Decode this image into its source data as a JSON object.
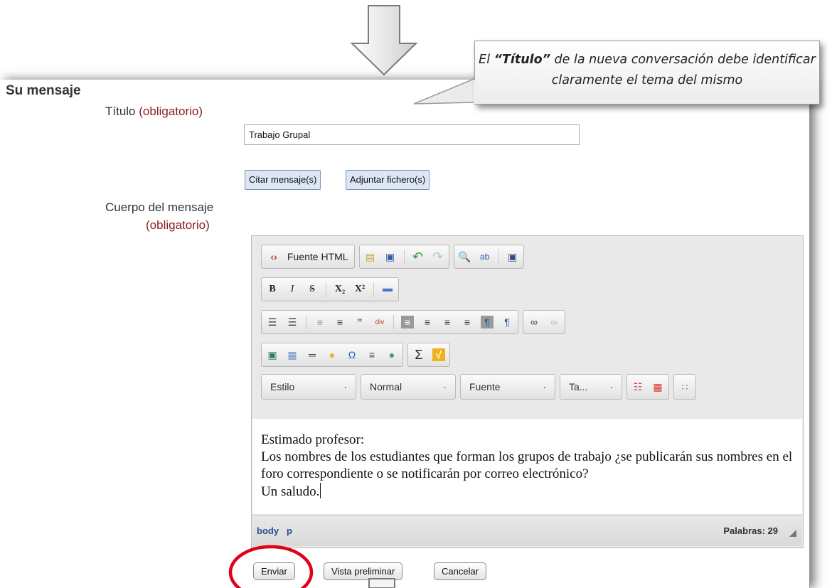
{
  "section_title": "Su mensaje",
  "title_field": {
    "label": "Título",
    "required": "(obligatorio)",
    "value": "Trabajo Grupal"
  },
  "buttons": {
    "quote": "Citar mensaje(s)",
    "attach": "Adjuntar fichero(s)"
  },
  "body_field": {
    "label": "Cuerpo del mensaje",
    "required": "(obligatorio)"
  },
  "editor": {
    "source_button": "Fuente HTML",
    "combos": {
      "style": "Estilo",
      "format": "Normal",
      "font": "Fuente",
      "size": "Ta..."
    },
    "content": {
      "line1": "Estimado profesor:",
      "line2": "Los nombres de los estudiantes que forman los grupos de trabajo ¿se publicarán sus nombres en el foro correspondiente o se notificarán por correo electrónico?",
      "line3": "Un saludo."
    },
    "path": [
      "body",
      "p"
    ],
    "word_count": "Palabras: 29"
  },
  "actions": {
    "send": "Enviar",
    "preview": "Vista preliminar",
    "cancel": "Cancelar"
  },
  "callout": {
    "pre": "El ",
    "emphasis": "“Título”",
    "post": " de la nueva conversación debe identificar claramente el tema del mismo"
  },
  "annotation_color": "#e0001a",
  "required_color": "#8b1a1a",
  "button_accent": "#dce6f5"
}
